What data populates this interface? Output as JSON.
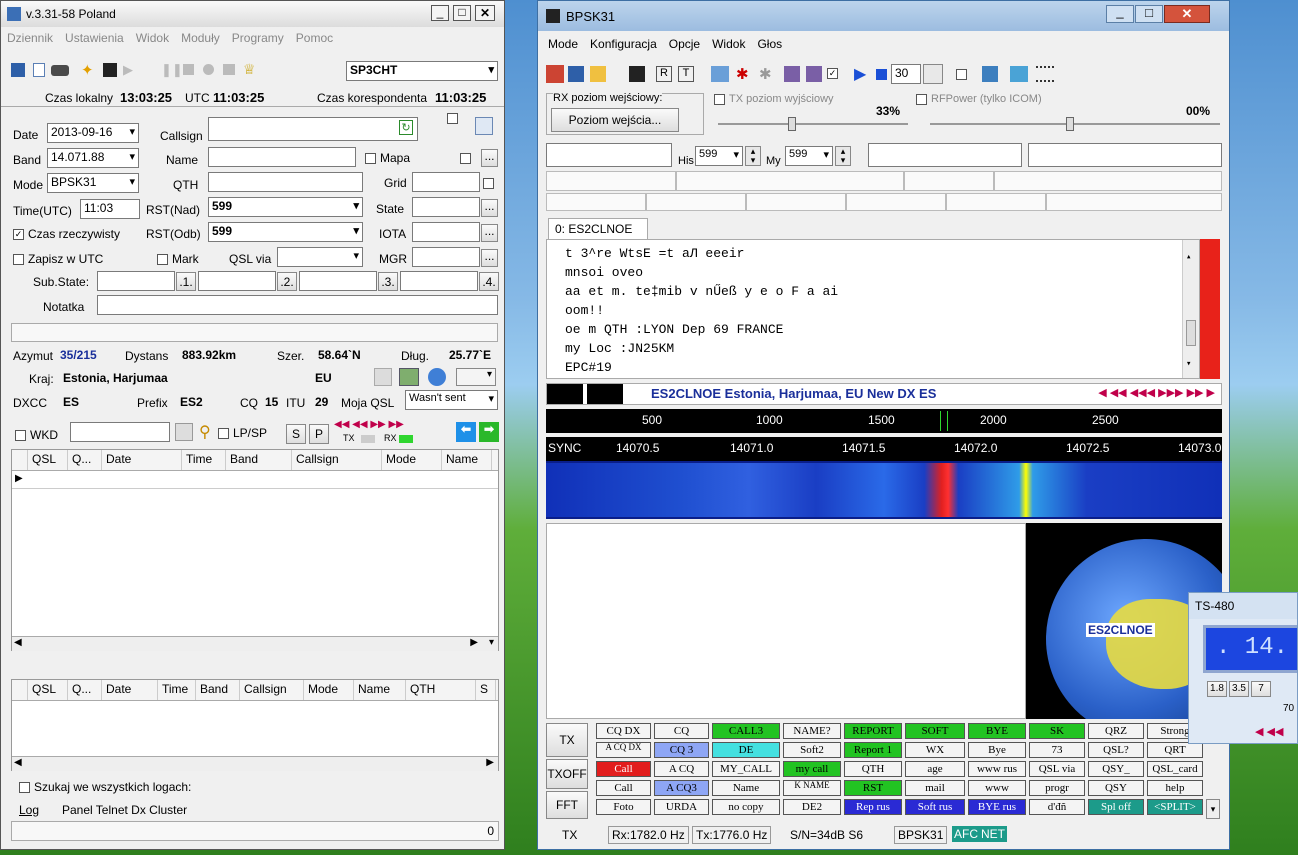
{
  "left": {
    "title": "v.3.31-58 Poland",
    "menu": [
      "Dziennik",
      "Ustawienia",
      "Widok",
      "Moduły",
      "Programy",
      "Pomoc"
    ],
    "callsign_box": "SP3CHT",
    "time_local_label": "Czas lokalny",
    "time_local": "13:03:25",
    "utc_label": "UTC",
    "utc": "11:03:25",
    "corr_label": "Czas korespondenta",
    "corr": "11:03:25",
    "date_label": "Date",
    "date": "2013-09-16",
    "callsign_label": "Callsign",
    "band_label": "Band",
    "band": "14.071.88",
    "name_label": "Name",
    "mapa_label": "Mapa",
    "mode_label": "Mode",
    "mode": "BPSK31",
    "qth_label": "QTH",
    "grid_label": "Grid",
    "time_label": "Time(UTC)",
    "time": "11:03",
    "rstn_label": "RST(Nad)",
    "rstn": "599",
    "state_label": "State",
    "realtime_label": "Czas rzeczywisty",
    "rsto_label": "RST(Odb)",
    "rsto": "599",
    "iota_label": "IOTA",
    "utc_save_label": "Zapisz w UTC",
    "mark_label": "Mark",
    "qslvia_label": "QSL via",
    "mgr_label": "MGR",
    "substate_label": "Sub.State:",
    "s1": ".1.",
    "s2": ".2.",
    "s3": ".3.",
    "s4": ".4.",
    "note_label": "Notatka",
    "azimuth_label": "Azymut",
    "azimuth": "35/215",
    "dist_label": "Dystans",
    "dist": "883.92km",
    "lat_label": "Szer.",
    "lat": "58.64`N",
    "lon_label": "Dług.",
    "lon": "25.77`E",
    "country_label": "Kraj:",
    "country": "Estonia, Harjumaa",
    "cont": "EU",
    "dxcc_label": "DXCC",
    "dxcc": "ES",
    "prefix_label": "Prefix",
    "prefix": "ES2",
    "cq_label": "CQ",
    "cq": "15",
    "itu_label": "ITU",
    "itu": "29",
    "myqsl_label": "Moja QSL",
    "myqsl": "Wasn't sent",
    "wkd_label": "WKD",
    "lpsp": "LP/SP",
    "s_btn": "S",
    "p_btn": "P",
    "tx": "TX",
    "rx": "RX",
    "grid1": [
      "QSL",
      "Q...",
      "Date",
      "Time",
      "Band",
      "Callsign",
      "Mode",
      "Name"
    ],
    "grid2": [
      "QSL",
      "Q...",
      "Date",
      "Time",
      "Band",
      "Callsign",
      "Mode",
      "Name",
      "QTH",
      "S"
    ],
    "search_all": "Szukaj we wszystkich logach:",
    "tabs": [
      "Log",
      "Panel Telnet Dx Cluster"
    ],
    "status_num": "0"
  },
  "main": {
    "title": "BPSK31",
    "menu": [
      "Mode",
      "Konfiguracja",
      "Opcje",
      "Widok",
      "Głos"
    ],
    "spin_val": "30",
    "rx_level_label": "RX poziom wejściowy:",
    "input_btn": "Poziom wejścia...",
    "tx_level_label": "TX poziom wyjściowy",
    "tx_pct": "33%",
    "rf_label": "RFPower (tylko ICOM)",
    "rf_pct": "00%",
    "his_label": "His",
    "his": "599",
    "my_label": "My",
    "my": "599",
    "tab": "0: ES2CLNOE",
    "rx_text": [
      "t 3^re WtsE =t aЛ     eeeir",
      "mnsoi oveo",
      "aa et  m. te‡mib v  nŰeß y e o  F a ai",
      "oom!!",
      "oe m  QTH :LYON Dep 69 FRANCE",
      "my Loc :JN25KM",
      "EPC#19"
    ],
    "dx_info": "ES2CLNOE Estonia, Harjumaa, EU New DX ES",
    "scale": [
      "500",
      "1000",
      "1500",
      "2000",
      "2500"
    ],
    "sync": "SYNC",
    "freqs": [
      "14070.5",
      "14071.0",
      "14071.5",
      "14072.0",
      "14072.5",
      "14073.0"
    ],
    "globe_label": "ES2CLNOE",
    "side_btns": [
      "TX",
      "TXOFF",
      "FFT"
    ],
    "macros": [
      [
        "CQ DX",
        "CQ",
        "CALL3",
        "NAME?",
        "REPORT",
        "SOFT",
        "BYE",
        "SK",
        "QRZ",
        "Strong"
      ],
      [
        "A CQ DX",
        "CQ 3",
        "DE",
        "Soft2",
        "Report 1",
        "WX",
        "Bye",
        "73",
        "QSL?",
        "QRT"
      ],
      [
        "Call",
        "A CQ",
        "MY_CALL",
        "my call",
        "QTH",
        "age",
        "www rus",
        "QSL via",
        "QSY_",
        "QSL_card"
      ],
      [
        "Call",
        "A CQ3",
        "Name",
        "K NAME",
        "RST",
        "mail",
        "www",
        "progr",
        "QSY",
        "help"
      ],
      [
        "Foto",
        "URDA",
        "no copy",
        "DE2",
        "Rep rus",
        "Soft rus",
        "BYE rus",
        "d'đñ",
        "Spl off",
        "<SPLIT>"
      ]
    ],
    "status": {
      "tx": "TX",
      "rx": "Rx:1782.0 Hz",
      "txf": "Tx:1776.0 Hz",
      "sn": "S/N=34dB S6",
      "mode": "BPSK31",
      "afc": "AFC",
      "net": "NET"
    }
  },
  "ts": {
    "title": "TS-480",
    "display": ". 14.",
    "bands": [
      "1.8",
      "3.5",
      "7"
    ],
    "extra": "70"
  }
}
